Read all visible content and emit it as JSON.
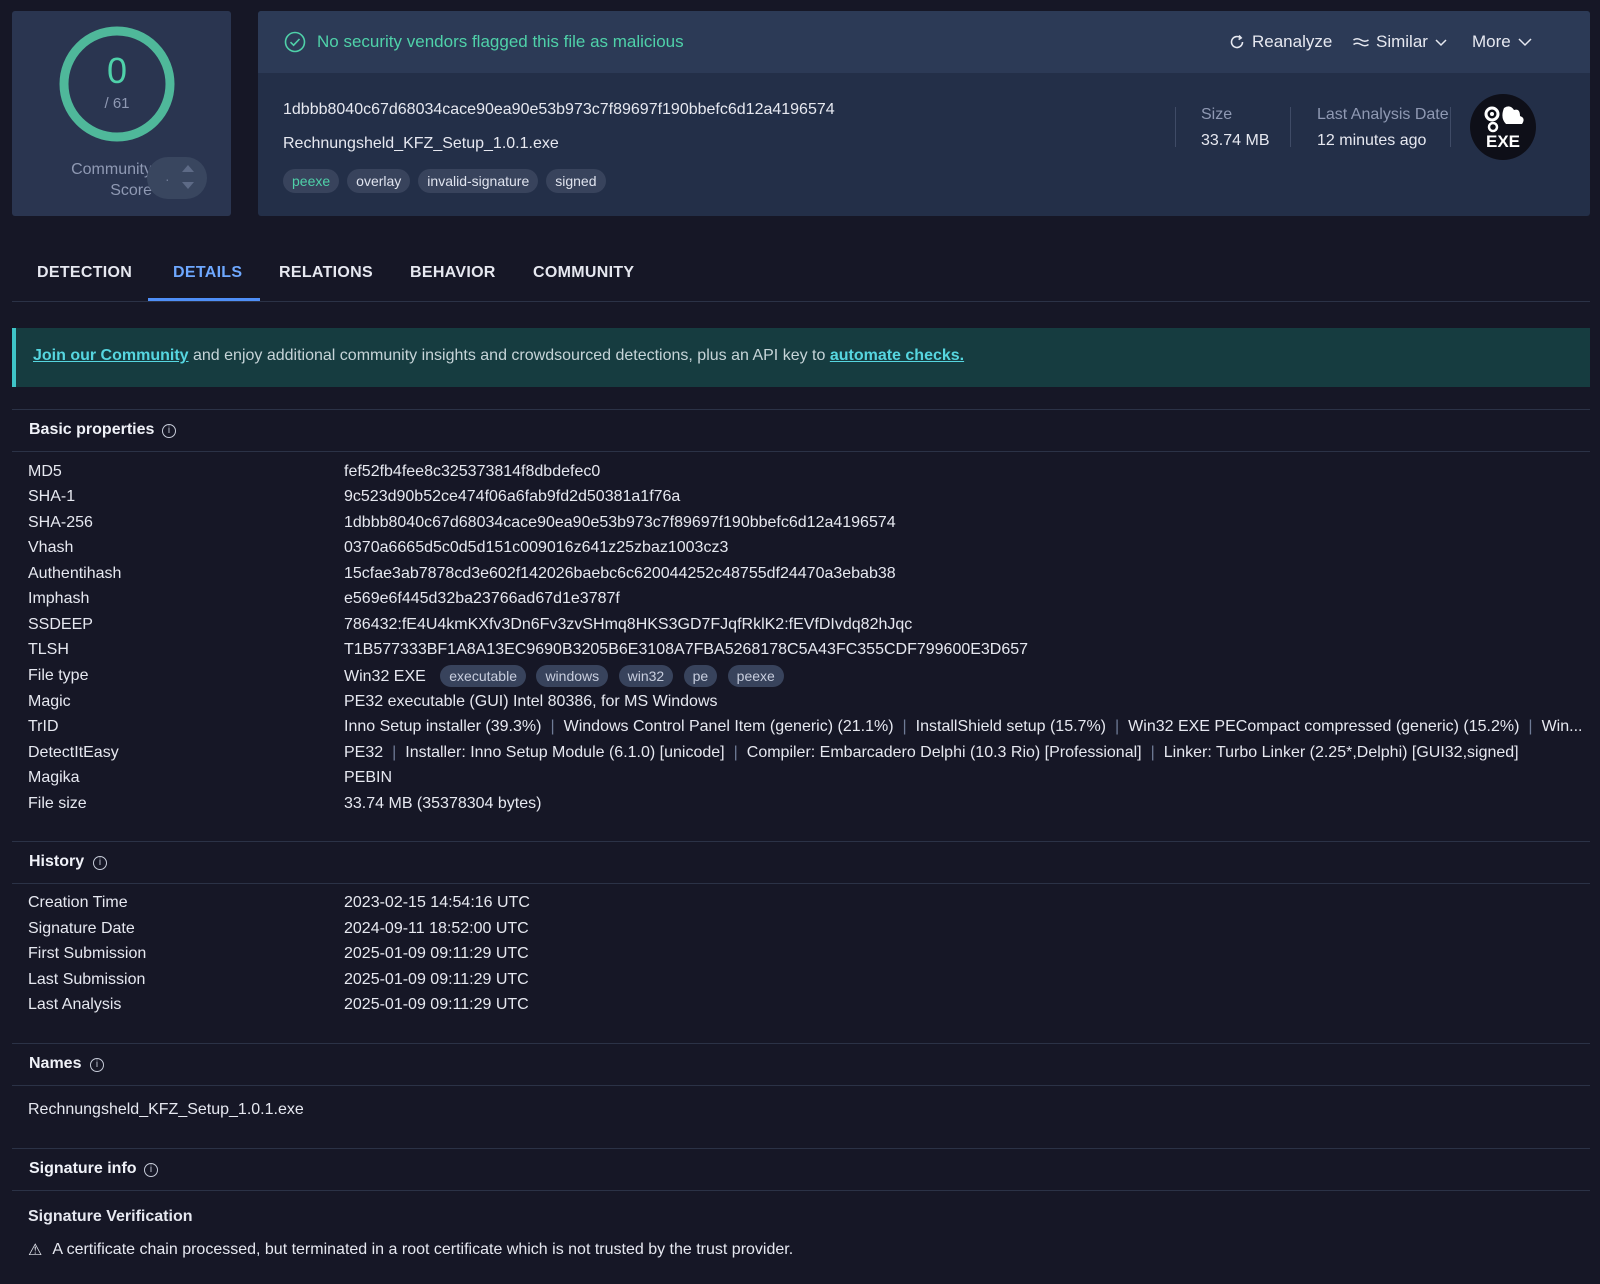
{
  "score": {
    "detections": "0",
    "total": "/ 61",
    "community_label_1": "Community",
    "community_label_2": "Score",
    "vote_dot": "·"
  },
  "status": {
    "message": "No security vendors flagged this file as malicious",
    "reanalyze_label": "Reanalyze",
    "similar_label": "Similar",
    "more_label": "More"
  },
  "file": {
    "hash": "1dbbb8040c67d68034cace90ea90e53b973c7f89697f190bbefc6d12a4196574",
    "name": "Rechnungsheld_KFZ_Setup_1.0.1.exe",
    "tags": [
      "peexe",
      "overlay",
      "invalid-signature",
      "signed"
    ],
    "size_label": "Size",
    "size_value": "33.74 MB",
    "date_label": "Last Analysis Date",
    "date_value": "12 minutes ago",
    "badge_text": "EXE"
  },
  "tabs": [
    "DETECTION",
    "DETAILS",
    "RELATIONS",
    "BEHAVIOR",
    "COMMUNITY"
  ],
  "active_tab": "DETAILS",
  "banner": {
    "link1": "Join our Community",
    "middle": " and enjoy additional community insights and crowdsourced detections, plus an API key to ",
    "link2": "automate checks."
  },
  "basic": {
    "title": "Basic properties",
    "rows": [
      {
        "key": "MD5",
        "value": "fef52fb4fee8c325373814f8dbdefec0"
      },
      {
        "key": "SHA-1",
        "value": "9c523d90b52ce474f06a6fab9fd2d50381a1f76a"
      },
      {
        "key": "SHA-256",
        "value": "1dbbb8040c67d68034cace90ea90e53b973c7f89697f190bbefc6d12a4196574"
      },
      {
        "key": "Vhash",
        "value": "0370a6665d5c0d5d151c009016z641z25zbaz1003cz3"
      },
      {
        "key": "Authentihash",
        "value": "15cfae3ab7878cd3e602f142026baebc6c620044252c48755df24470a3ebab38"
      },
      {
        "key": "Imphash",
        "value": "e569e6f445d32ba23766ad67d1e3787f"
      },
      {
        "key": "SSDEEP",
        "value": "786432:fE4U4kmKXfv3Dn6Fv3zvSHmq8HKS3GD7FJqfRklK2:fEVfDIvdq82hJqc"
      },
      {
        "key": "TLSH",
        "value": "T1B577333BF1A8A13EC9690B3205B6E3108A7FBA5268178C5A43FC355CDF799600E3D657"
      }
    ],
    "filetype_key": "File type",
    "filetype_value": "Win32 EXE",
    "filetype_chips": [
      "executable",
      "windows",
      "win32",
      "pe",
      "peexe"
    ],
    "magic_key": "Magic",
    "magic_value": "PE32 executable (GUI) Intel 80386, for MS Windows",
    "trid_key": "TrID",
    "trid_items": [
      "Inno Setup installer (39.3%)",
      "Windows Control Panel Item (generic) (21.1%)",
      "InstallShield setup (15.7%)",
      "Win32 EXE PECompact compressed (generic) (15.2%)",
      "Win..."
    ],
    "die_key": "DetectItEasy",
    "die_items": [
      "PE32",
      "Installer: Inno Setup Module (6.1.0) [unicode]",
      "Compiler: Embarcadero Delphi (10.3 Rio) [Professional]",
      "Linker: Turbo Linker (2.25*,Delphi) [GUI32,signed]"
    ],
    "magika_key": "Magika",
    "magika_value": "PEBIN",
    "filesize_key": "File size",
    "filesize_value": "33.74 MB (35378304 bytes)"
  },
  "history": {
    "title": "History",
    "rows": [
      {
        "key": "Creation Time",
        "value": "2023-02-15 14:54:16 UTC"
      },
      {
        "key": "Signature Date",
        "value": "2024-09-11 18:52:00 UTC"
      },
      {
        "key": "First Submission",
        "value": "2025-01-09 09:11:29 UTC"
      },
      {
        "key": "Last Submission",
        "value": "2025-01-09 09:11:29 UTC"
      },
      {
        "key": "Last Analysis",
        "value": "2025-01-09 09:11:29 UTC"
      }
    ]
  },
  "names": {
    "title": "Names",
    "value": "Rechnungsheld_KFZ_Setup_1.0.1.exe"
  },
  "signature": {
    "title": "Signature info",
    "verification_label": "Signature Verification",
    "warning_icon": "⚠",
    "warning": "A certificate chain processed, but terminated in a root certificate which is not trusted by the trust provider."
  },
  "icons": {
    "info": "i",
    "ring_color": "#4fb89a",
    "accent": "#4f8ff7"
  }
}
